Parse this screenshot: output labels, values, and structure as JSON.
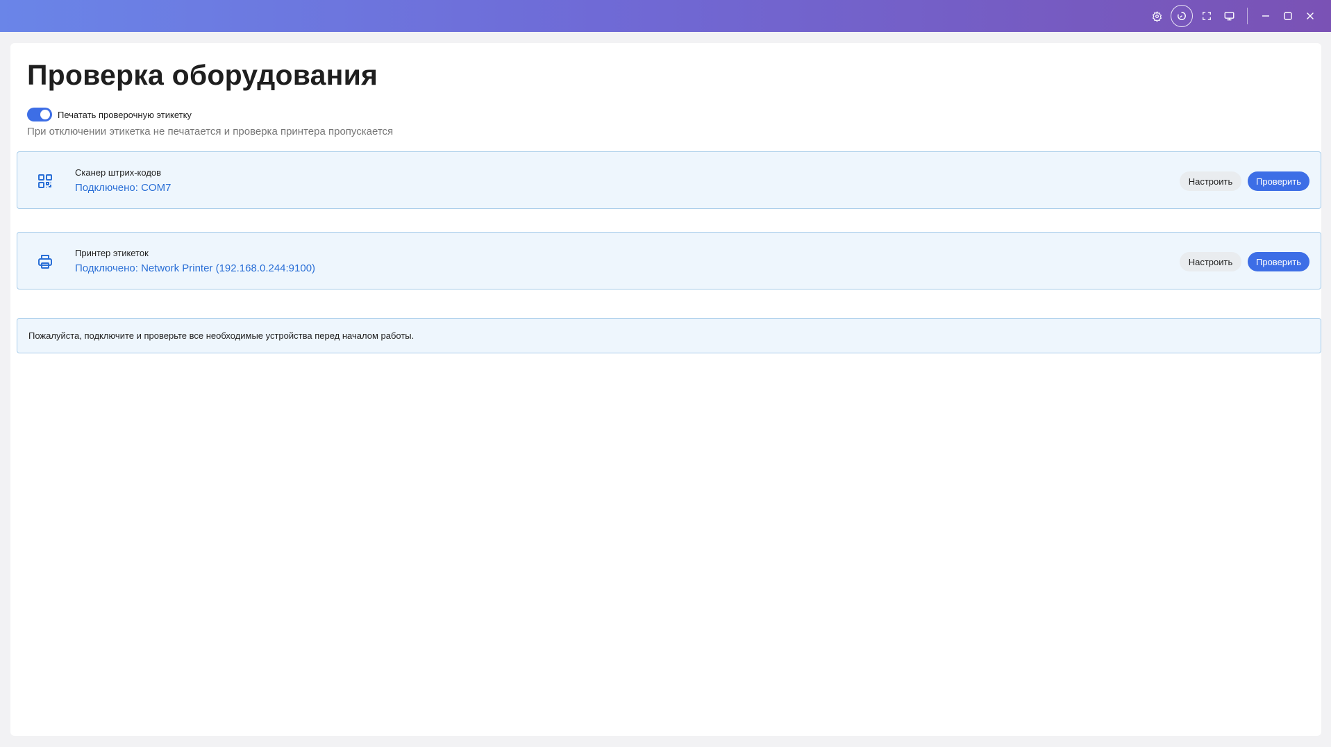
{
  "titlebar": {
    "icons": [
      "gear-icon",
      "clock-icon",
      "fullscreen-icon",
      "monitor-icon",
      "minimize-icon",
      "maximize-icon",
      "close-icon"
    ]
  },
  "page": {
    "title": "Проверка оборудования",
    "toggle": {
      "label": "Печатать проверочную этикетку",
      "on": true,
      "hint": "При отключении этикетка не печатается и проверка принтера пропускается"
    }
  },
  "devices": [
    {
      "icon": "qr-code-icon",
      "name": "Сканер штрих-кодов",
      "status": "Подключено: COM7",
      "configure_label": "Настроить",
      "check_label": "Проверить"
    },
    {
      "icon": "printer-icon",
      "name": "Принтер этикеток",
      "status": "Подключено: Network Printer (192.168.0.244:9100)",
      "configure_label": "Настроить",
      "check_label": "Проверить"
    }
  ],
  "info": {
    "message": "Пожалуйста, подключите и проверьте все необходимые устройства перед началом работы."
  },
  "colors": {
    "accent": "#3d6ee6",
    "link": "#2a6fd6",
    "card_bg": "#eef6fd",
    "card_border": "#a9cdea",
    "titlebar_start": "#6a85e8",
    "titlebar_end": "#7a52b5"
  }
}
